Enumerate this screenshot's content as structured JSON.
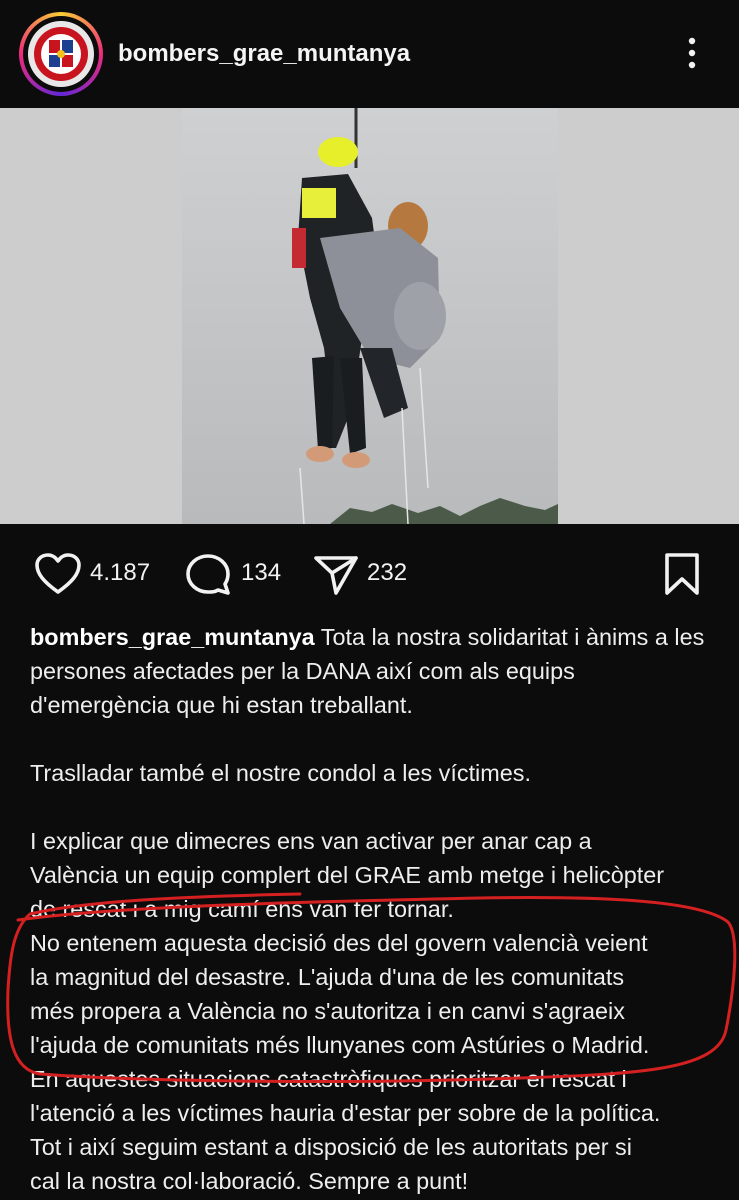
{
  "post": {
    "username": "bombers_grae_muntanya",
    "more_icon": "more-vertical-icon",
    "avatar_icon": "fire-department-logo-icon"
  },
  "actions": {
    "likes": "4.187",
    "comments": "134",
    "shares": "232",
    "like_icon": "heart-icon",
    "comment_icon": "comment-bubble-icon",
    "share_icon": "paper-plane-icon",
    "save_icon": "bookmark-icon"
  },
  "caption": {
    "username": "bombers_grae_muntanya",
    "para1": "Tota la nostra solidaritat i ànims a les persones afectades per la DANA així com als equips d'emergència que hi estan treballant.",
    "para2": "Traslladar també el nostre condol a les víctimes.",
    "para3_lines": [
      "I explicar que dimecres ens van activar per anar cap a",
      "València un equip complert del GRAE amb metge i helicòpter",
      "de rescat i a mig camí ens van fer tornar.",
      "No entenem aquesta decisió des del govern valencià veient",
      "la magnitud del desastre. L'ajuda d'una de les comunitats",
      "més propera a València no s'autoritza i en canvi s'agraeix",
      "l'ajuda de comunitats més llunyanes com Astúries o Madrid.",
      "En aquestes situacions catastròfiques prioritzar el rescat i",
      "l'atenció a les víctimes hauria d'estar per sobre de la política.",
      "Tot i així seguim estant a disposició de les autoritats per si",
      "cal la nostra col·laboració. Sempre a punt!"
    ]
  },
  "colors": {
    "background": "#0c0c0c",
    "text": "#f2f2f2",
    "annotation_red": "#d42020"
  }
}
